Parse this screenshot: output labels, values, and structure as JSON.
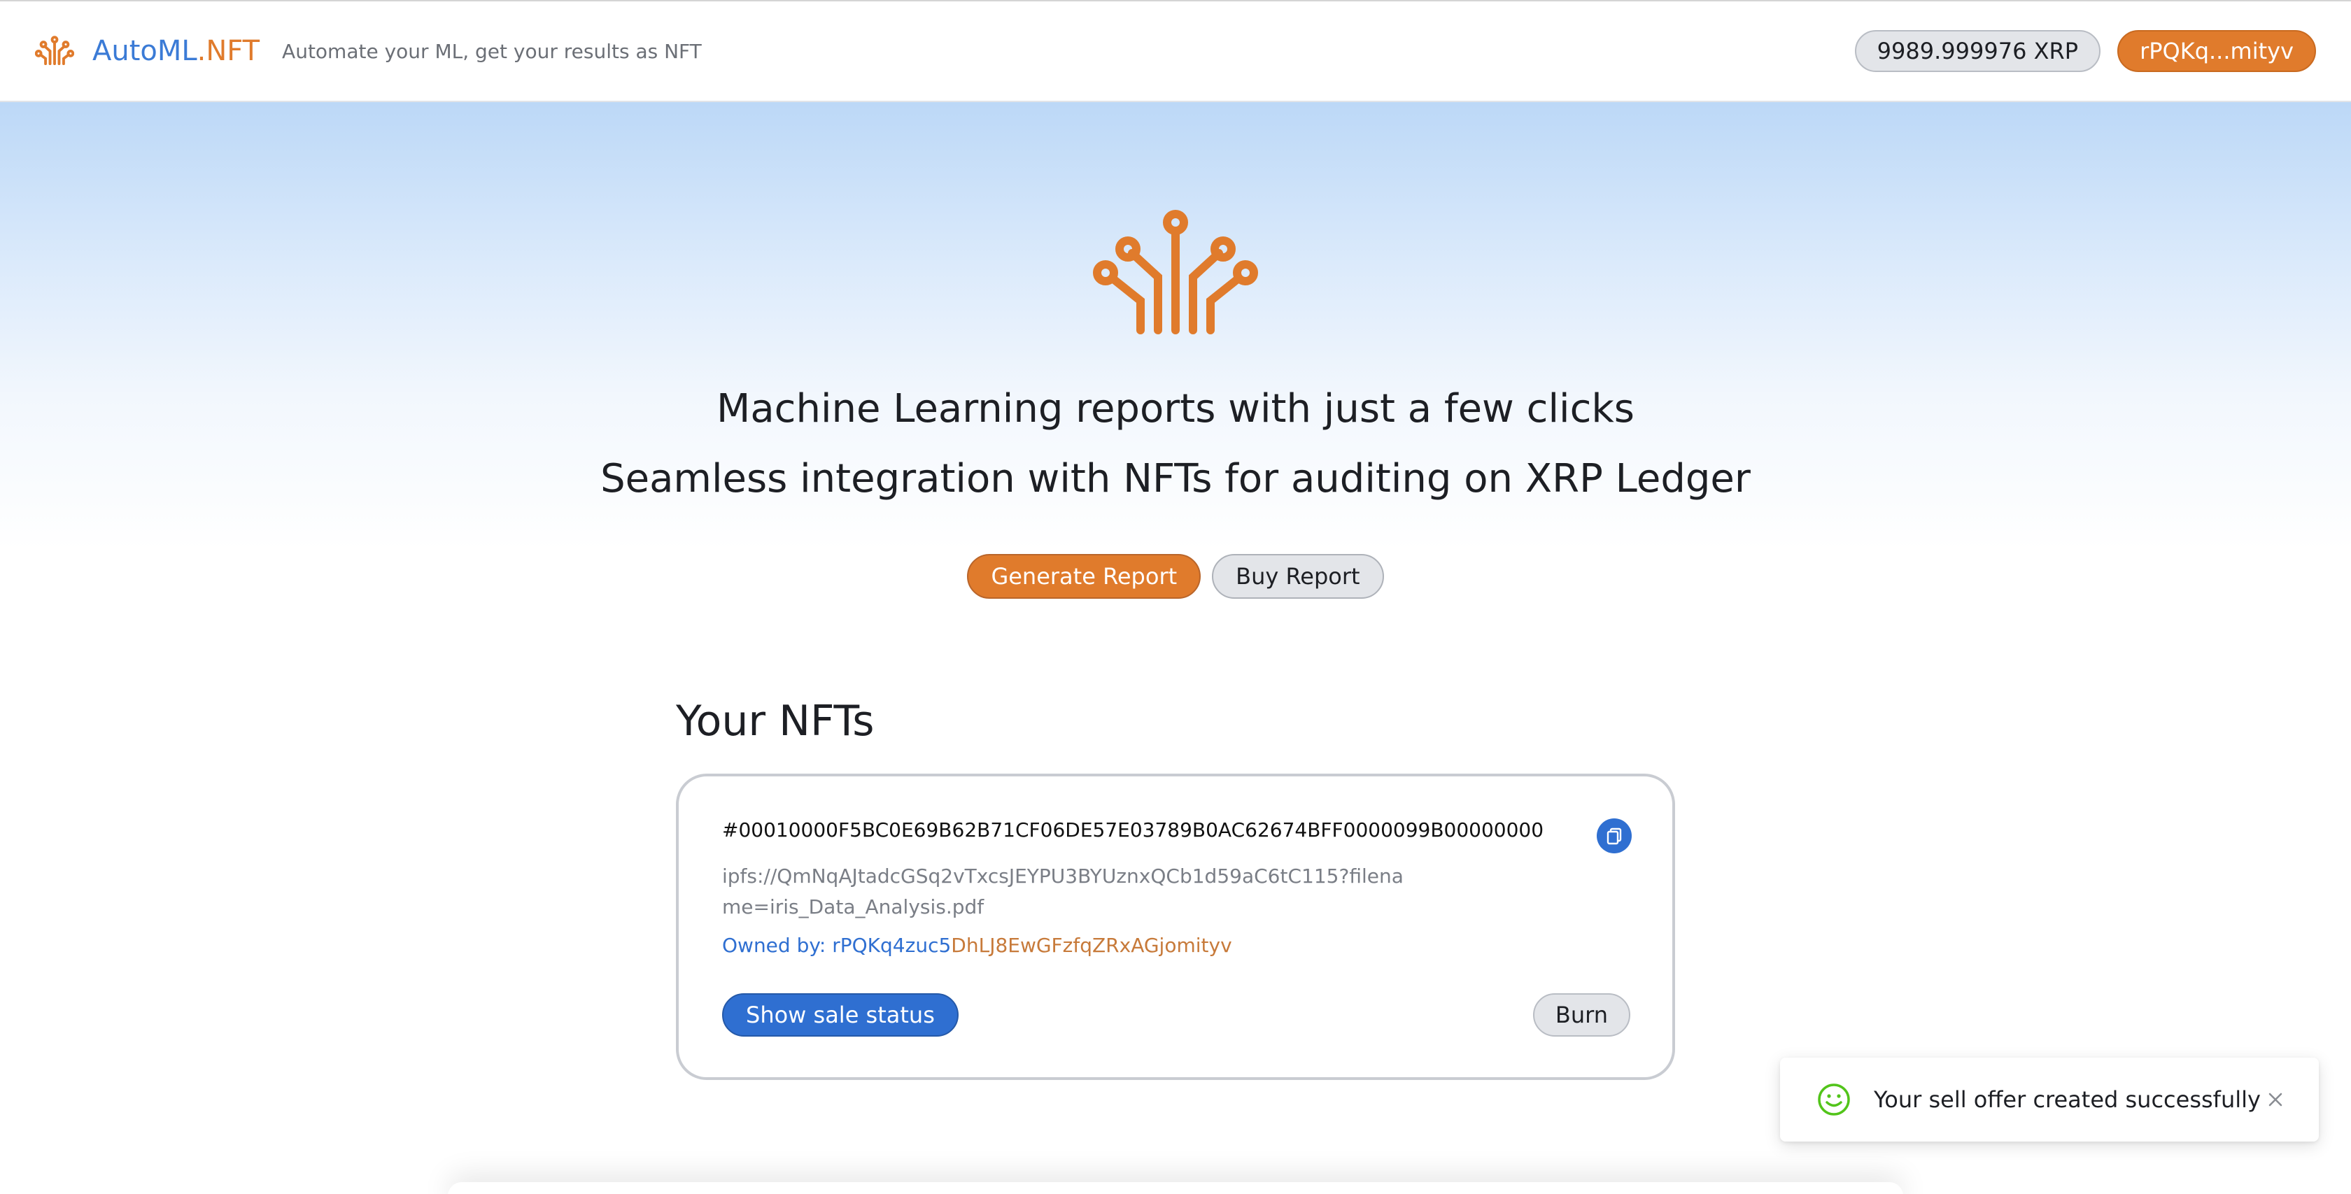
{
  "header": {
    "brand_part1": "AutoML",
    "brand_part2": ".NFT",
    "tagline": "Automate your ML, get your results as NFT",
    "balance": "9989.999976 XRP",
    "account": "rPQKq...mityv"
  },
  "hero": {
    "line1": "Machine Learning reports with just a few clicks",
    "line2": "Seamless integration with NFTs for auditing on XRP Ledger",
    "generate_label": "Generate Report",
    "buy_label": "Buy Report"
  },
  "nfts": {
    "title": "Your NFTs",
    "items": [
      {
        "id": "#00010000F5BC0E69B62B71CF06DE57E03789B0AC62674BFF0000099B00000000",
        "uri": "ipfs://QmNqAJtadcGSq2vTxcsJEYPU3BYUznxQCb1d59aC6tC115?filename=iris_Data_Analysis.pdf",
        "owner_label": "Owned by:",
        "owner_addr_part1": "rPQKq4zuc5",
        "owner_addr_part2": "DhLJ8EwGFzfqZRxAGjomityv",
        "show_sale_label": "Show sale status",
        "burn_label": "Burn"
      }
    ]
  },
  "toast": {
    "message": "Your sell offer created successfully"
  },
  "colors": {
    "accent_orange": "#e07b2c",
    "accent_blue": "#2f6fd1",
    "success_green": "#52c41a"
  },
  "icons": {
    "logo": "circuit-tree-icon",
    "copy": "copy-icon",
    "toast": "smile-icon",
    "close": "close-icon"
  }
}
